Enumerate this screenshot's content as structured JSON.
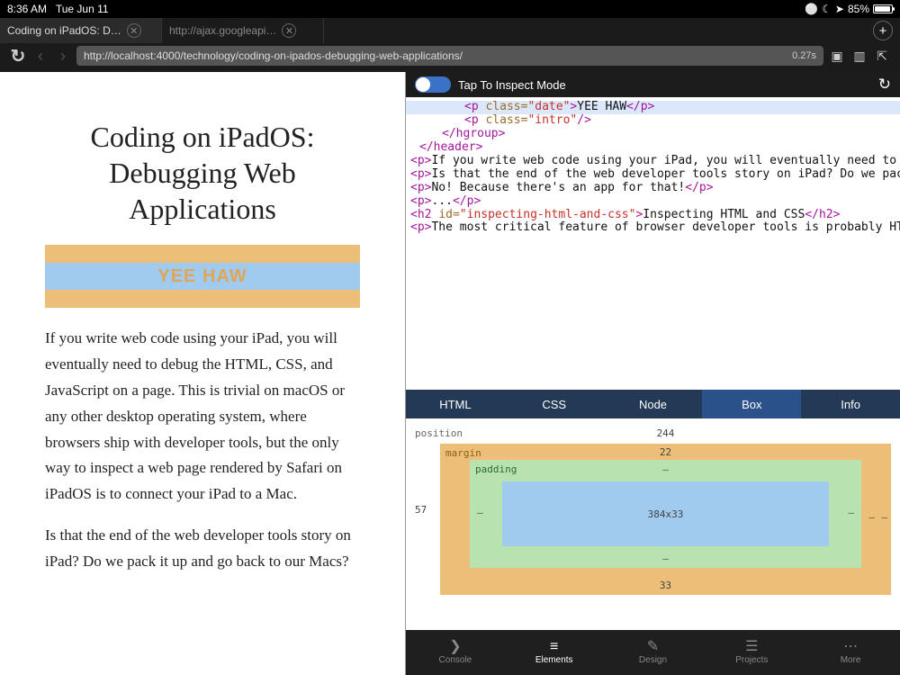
{
  "status": {
    "time": "8:36 AM",
    "date": "Tue Jun 11",
    "battery": "85%"
  },
  "tabs": [
    {
      "title": "Coding on iPadOS: D…",
      "active": true
    },
    {
      "title": "http://ajax.googleapi…",
      "active": false
    }
  ],
  "url": "http://localhost:4000/technology/coding-on-ipados-debugging-web-applications/",
  "load_time": "0.27s",
  "article": {
    "title": "Coding on iPadOS: Debugging Web Applications",
    "highlight_text": "YEE HAW",
    "p1": "If you write web code using your iPad, you will eventually need to debug the HTML, CSS, and JavaScript on a page. This is trivial on macOS or any other desktop operating system, where browsers ship with developer tools, but the only way to inspect a web page rendered by Safari on iPadOS is to connect your iPad to a Mac.",
    "p2": "Is that the end of the web developer tools story on iPad? Do we pack it up and go back to our Macs?"
  },
  "inspector": {
    "mode_label": "Tap To Inspect Mode",
    "src": {
      "date_text": "YEE HAW",
      "para_text": "If you write web code using your iPad, you will eventually need to debug the HTML, CSS, and JavaScript on a page. This is trivial on macOS or any other desktop operating system, where browsers ship with developer tools, but the only way to inspect a web page rendered by Safari on iPadOS is to connect your iPad to a Mac.",
      "q_text": "Is that the end of the web developer tools story on iPad? Do we pack it up and go back to our Macs?",
      "no_text": "No! Because there's an app for that!",
      "ell": "...",
      "h2_text": "Inspecting HTML and CSS",
      "last_text": "The most critical feature of browser developer tools is probably HTML and CSS inspection. As a developer, I want to point t"
    },
    "tabs": [
      "HTML",
      "CSS",
      "Node",
      "Box",
      "Info"
    ],
    "active_tab": "Box",
    "box": {
      "position_label": "position",
      "margin_label": "margin",
      "padding_label": "padding",
      "top": "244",
      "margin_top": "22",
      "margin_bottom": "33",
      "left": "57",
      "pad": "–",
      "content": "384x33"
    }
  },
  "bottom": [
    {
      "icon": "❯",
      "label": "Console"
    },
    {
      "icon": "≡",
      "label": "Elements"
    },
    {
      "icon": "✎",
      "label": "Design"
    },
    {
      "icon": "☰",
      "label": "Projects"
    },
    {
      "icon": "⋯",
      "label": "More"
    }
  ],
  "bottom_active": "Elements",
  "icons": {
    "wifi": "⚪",
    "moon": "☾",
    "loc": "➤",
    "reload": "↻",
    "back": "‹",
    "fwd": "›",
    "plus": "+",
    "close": "✕",
    "cam": "▣",
    "book": "▥",
    "share": "⇱"
  }
}
